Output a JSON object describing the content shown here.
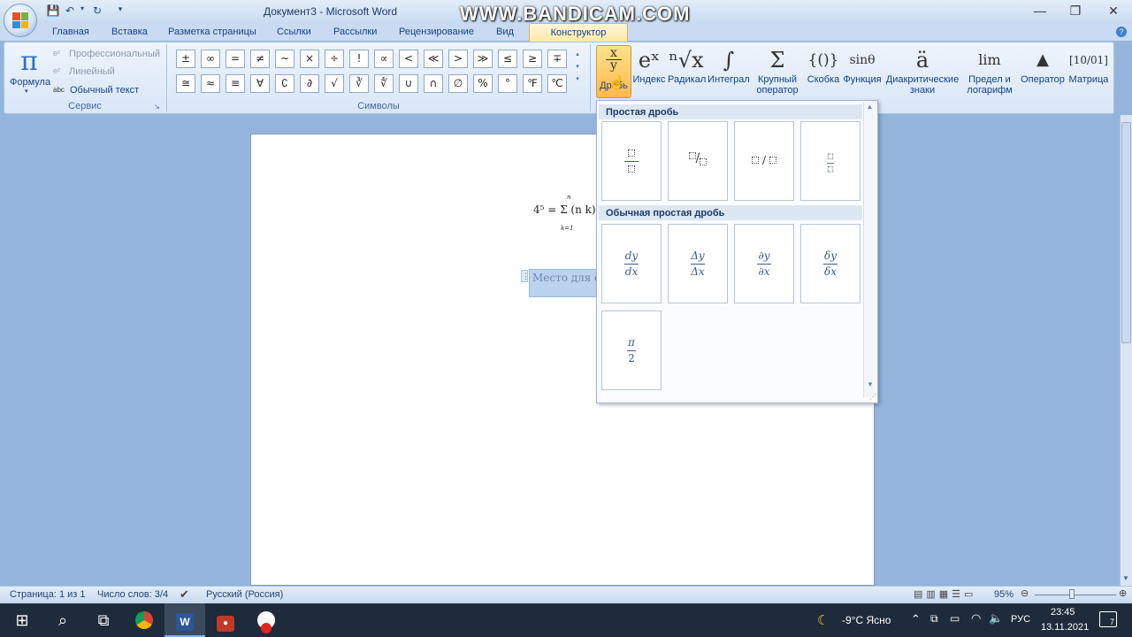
{
  "window": {
    "title": "Документ3 - Microsoft Word",
    "recorder_watermark": "WWW.BANDICAM.COM"
  },
  "tabs": [
    "Главная",
    "Вставка",
    "Разметка страницы",
    "Ссылки",
    "Рассылки",
    "Рецензирование",
    "Вид",
    "Конструктор"
  ],
  "ribbon": {
    "service_group": {
      "formula_label": "Формула",
      "professional": "Профессиональный",
      "linear": "Линейный",
      "plain_text": "Обычный текст",
      "label": "Сервис"
    },
    "symbols_group": {
      "label": "Символы",
      "row1": [
        "±",
        "∞",
        "=",
        "≠",
        "~",
        "×",
        "÷",
        "!",
        "∝",
        "<",
        "≪",
        ">",
        "≫",
        "≤",
        "≥",
        "∓"
      ],
      "row2": [
        "≅",
        "≈",
        "≡",
        "∀",
        "∁",
        "∂",
        "√",
        "∛",
        "∜",
        "∪",
        "∩",
        "∅",
        "%",
        "°",
        "℉",
        "℃"
      ]
    },
    "structures": [
      {
        "icon": "x/y",
        "label": "Дробь"
      },
      {
        "icon": "eˣ",
        "label": "Индекс"
      },
      {
        "icon": "ⁿ√x",
        "label": "Радикал"
      },
      {
        "icon": "∫",
        "label": "Интеграл"
      },
      {
        "icon": "Σ",
        "label": "Крупный оператор"
      },
      {
        "icon": "{()}",
        "label": "Скобка"
      },
      {
        "icon": "sinθ",
        "label": "Функция"
      },
      {
        "icon": "ä",
        "label": "Диакритические знаки"
      },
      {
        "icon": "lim",
        "label": "Предел и логарифм"
      },
      {
        "icon": "▲",
        "label": "Оператор"
      },
      {
        "icon": "[10/01]",
        "label": "Матрица"
      }
    ]
  },
  "gallery": {
    "section1": "Простая дробь",
    "section2": "Обычная простая дробь",
    "common": [
      {
        "num": "dy",
        "den": "dx"
      },
      {
        "num": "Δy",
        "den": "Δx"
      },
      {
        "num": "∂y",
        "den": "∂x"
      },
      {
        "num": "δy",
        "den": "δx"
      },
      {
        "num": "π",
        "den": "2"
      }
    ]
  },
  "document": {
    "equation": "4⁵ = Σ (n k)",
    "sum_top": "n",
    "sum_bottom": "k=1",
    "placeholder": "Место для ф"
  },
  "statusbar": {
    "page": "Страница: 1 из 1",
    "words": "Число слов: 3/4",
    "language": "Русский (Россия)",
    "zoom": "95%"
  },
  "taskbar": {
    "weather": "-9°C  Ясно",
    "lang": "РУС",
    "time": "23:45",
    "date": "13.11.2021",
    "notifications": "7"
  }
}
